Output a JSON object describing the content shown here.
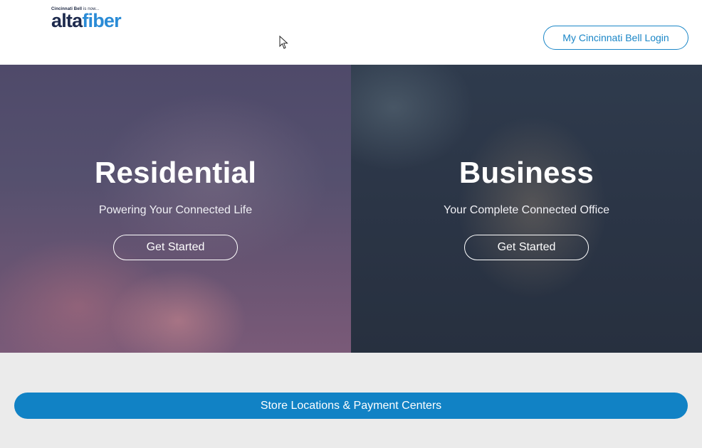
{
  "header": {
    "logo": {
      "tagline": "Cincinnati Bell",
      "tagline_suffix": " is now...",
      "word_alta": "alta",
      "word_fiber": "fiber"
    },
    "login_label": "My Cincinnati Bell Login"
  },
  "hero": {
    "residential": {
      "title": "Residential",
      "subtitle": "Powering Your Connected Life",
      "button": "Get Started"
    },
    "business": {
      "title": "Business",
      "subtitle": "Your Complete Connected Office",
      "button": "Get Started"
    }
  },
  "store_button": "Store Locations & Payment Centers",
  "colors": {
    "accent": "#1182c5",
    "logo_dark": "#1d2a4d",
    "logo_blue": "#2a8bd6",
    "page_bg": "#ebebeb"
  }
}
